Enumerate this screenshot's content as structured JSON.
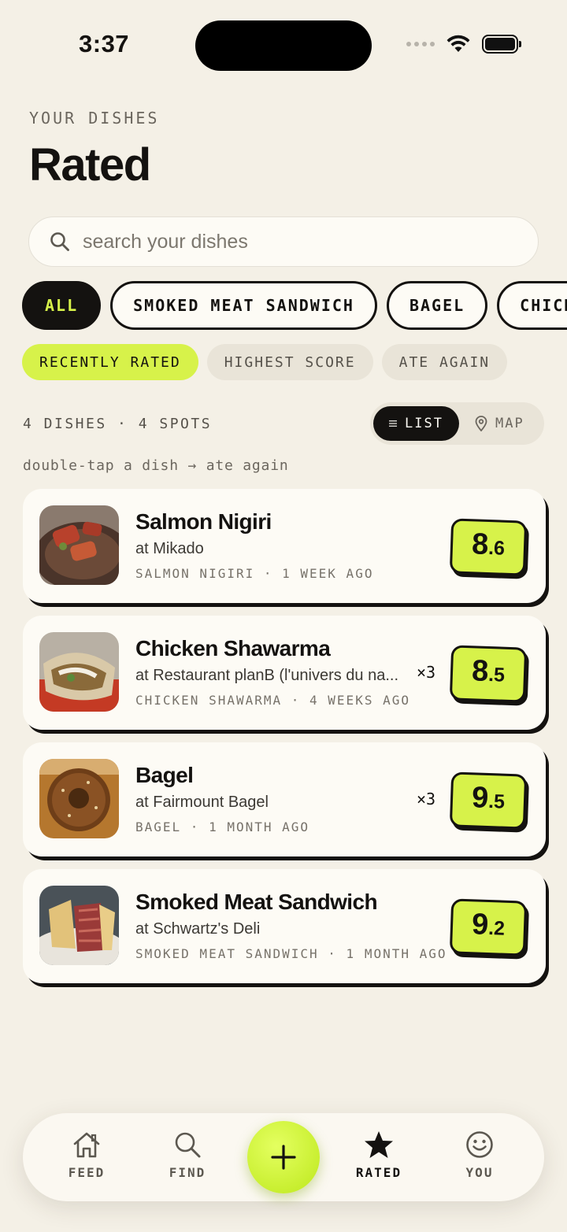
{
  "status": {
    "time": "3:37"
  },
  "header": {
    "eyebrow": "YOUR DISHES",
    "title": "Rated"
  },
  "search": {
    "placeholder": "search your dishes",
    "value": ""
  },
  "filter_chips": [
    "ALL",
    "SMOKED MEAT SANDWICH",
    "BAGEL",
    "CHICKEN SHAWARMA"
  ],
  "filter_active": "ALL",
  "sort_options": [
    "RECENTLY RATED",
    "HIGHEST SCORE",
    "ATE AGAIN"
  ],
  "sort_active": "RECENTLY RATED",
  "summary": "4 DISHES · 4 SPOTS",
  "view_toggle": {
    "list": "LIST",
    "map": "MAP",
    "active": "LIST"
  },
  "hint": "double-tap a dish → ate again",
  "dishes": [
    {
      "name": "Salmon Nigiri",
      "place": "at Mikado",
      "meta": "SALMON NIGIRI · 1 WEEK AGO",
      "repeat": "",
      "score_int": "8",
      "score_dec": ".6"
    },
    {
      "name": "Chicken Shawarma",
      "place": "at Restaurant planB (l'univers du na...",
      "meta": "CHICKEN SHAWARMA · 4 WEEKS AGO",
      "repeat": "×3",
      "score_int": "8",
      "score_dec": ".5"
    },
    {
      "name": "Bagel",
      "place": "at Fairmount Bagel",
      "meta": "BAGEL · 1 MONTH AGO",
      "repeat": "×3",
      "score_int": "9",
      "score_dec": ".5"
    },
    {
      "name": "Smoked Meat Sandwich",
      "place": "at Schwartz's Deli",
      "meta": "SMOKED MEAT SANDWICH · 1 MONTH AGO",
      "repeat": "",
      "score_int": "9",
      "score_dec": ".2"
    }
  ],
  "tabbar": {
    "feed": "FEED",
    "find": "FIND",
    "rated": "RATED",
    "you": "YOU",
    "active": "RATED"
  },
  "colors": {
    "accent": "#d7f24a",
    "ink": "#141210",
    "background": "#f4f0e6"
  }
}
